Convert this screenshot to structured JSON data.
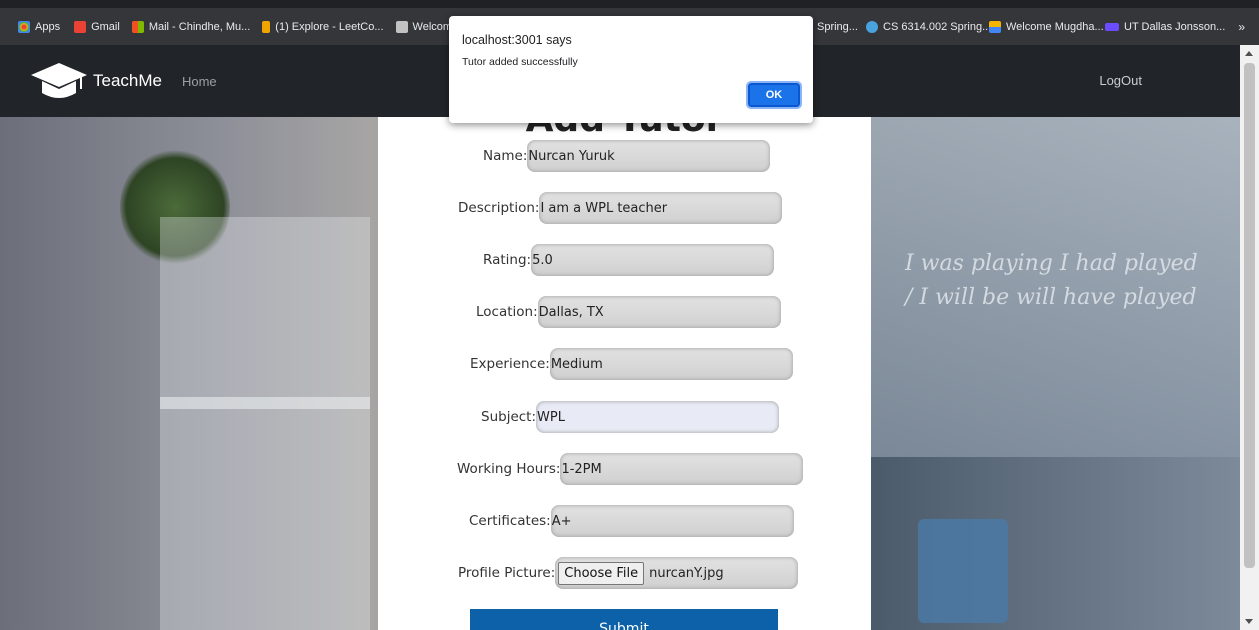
{
  "bookmarks": [
    {
      "label": "Apps",
      "icon": "apps-grid-icon",
      "color": "#ea4335"
    },
    {
      "label": "Gmail",
      "icon": "gmail-icon",
      "color": "#ea4335"
    },
    {
      "label": "Mail - Chindhe, Mu...",
      "icon": "outlook-icon",
      "color": "#f25022"
    },
    {
      "label": "(1) Explore - LeetCo...",
      "icon": "leetcode-icon",
      "color": "#f0a500"
    },
    {
      "label": "Welcome, M",
      "icon": "web-icon",
      "color": "#c2c2c2"
    },
    {
      "label": "Spring...",
      "icon": "web-icon",
      "color": "#c2c2c2"
    },
    {
      "label": "CS 6314.002 Spring...",
      "icon": "course-icon",
      "color": "#4aa3df"
    },
    {
      "label": "Welcome Mugdha...",
      "icon": "welcome-icon",
      "color": "#f4b400"
    },
    {
      "label": "UT Dallas Jonsson...",
      "icon": "xm-icon",
      "color": "#6c4cff"
    }
  ],
  "bookmarks_more": "»",
  "nav": {
    "brand": "TeachMe",
    "home": "Home",
    "logout": "LogOut"
  },
  "form": {
    "title": "Add Tutor",
    "fields": [
      {
        "label": "Name:",
        "value": "Nurcan Yuruk"
      },
      {
        "label": "Description:",
        "value": "I am a WPL teacher"
      },
      {
        "label": "Rating:",
        "value": "5.0"
      },
      {
        "label": "Location:",
        "value": "Dallas, TX"
      },
      {
        "label": "Experience:",
        "value": "Medium"
      },
      {
        "label": "Subject:",
        "value": "WPL"
      },
      {
        "label": "Working Hours:",
        "value": "1-2PM"
      },
      {
        "label": "Certificates:",
        "value": "A+"
      }
    ],
    "picture_label": "Profile Picture:",
    "choose_file": "Choose File",
    "file_name": "nurcanY.jpg",
    "submit": "Submit"
  },
  "dialog": {
    "title": "localhost:3001 says",
    "message": "Tutor added successfully",
    "ok": "OK"
  },
  "background_text": "I was playing I had played / I will be will have played"
}
